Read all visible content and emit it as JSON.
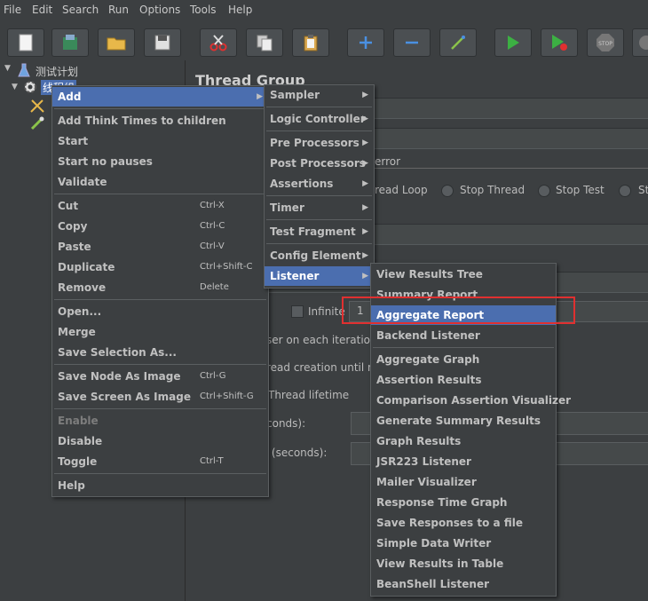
{
  "menubar": [
    "File",
    "Edit",
    "Search",
    "Run",
    "Options",
    "Tools",
    "Help"
  ],
  "toolbar": {
    "buttons": [
      "new",
      "templates",
      "open",
      "save",
      "cut",
      "copy",
      "paste",
      "expand",
      "collapse",
      "toggle",
      "start",
      "start-no-pauses",
      "stop",
      "shutdown"
    ],
    "stop_text": "STOP"
  },
  "tree": {
    "root_label": "测试计划",
    "child_label": "线程组"
  },
  "main": {
    "title": "Thread Group",
    "error_label": "error",
    "radio_labels": [
      "read Loop",
      "Stop Thread",
      "Stop Test",
      "St"
    ],
    "infinite_label": "Infinite",
    "loop_value": "1",
    "row_labels": [
      "ser on each iteration",
      "read creation until n",
      "Thread lifetime",
      "conds):",
      "y (seconds):"
    ]
  },
  "context_menu": {
    "items": [
      {
        "label": "Add",
        "submenu": true,
        "selected": true
      },
      {
        "label": "Add Think Times to children"
      },
      {
        "label": "Start"
      },
      {
        "label": "Start no pauses"
      },
      {
        "label": "Validate"
      },
      {
        "label": "Cut",
        "accel": "Ctrl-X"
      },
      {
        "label": "Copy",
        "accel": "Ctrl-C"
      },
      {
        "label": "Paste",
        "accel": "Ctrl-V"
      },
      {
        "label": "Duplicate",
        "accel": "Ctrl+Shift-C"
      },
      {
        "label": "Remove",
        "accel": "Delete"
      },
      {
        "label": "Open..."
      },
      {
        "label": "Merge"
      },
      {
        "label": "Save Selection As..."
      },
      {
        "label": "Save Node As Image",
        "accel": "Ctrl-G"
      },
      {
        "label": "Save Screen As Image",
        "accel": "Ctrl+Shift-G"
      },
      {
        "label": "Enable",
        "disabled": true
      },
      {
        "label": "Disable"
      },
      {
        "label": "Toggle",
        "accel": "Ctrl-T"
      },
      {
        "label": "Help"
      }
    ]
  },
  "add_menu": {
    "items": [
      "Sampler",
      "Logic Controller",
      "Pre Processors",
      "Post Processors",
      "Assertions",
      "Timer",
      "Test Fragment",
      "Config Element",
      "Listener"
    ],
    "selected": "Listener"
  },
  "listener_menu": {
    "items": [
      "View Results Tree",
      "Summary Report",
      "Aggregate Report",
      "Backend Listener",
      "Aggregate Graph",
      "Assertion Results",
      "Comparison Assertion Visualizer",
      "Generate Summary Results",
      "Graph Results",
      "JSR223 Listener",
      "Mailer Visualizer",
      "Response Time Graph",
      "Save Responses to a file",
      "Simple Data Writer",
      "View Results in Table",
      "BeanShell Listener"
    ],
    "selected": "Aggregate Report",
    "highlight_color": "#e03030"
  }
}
